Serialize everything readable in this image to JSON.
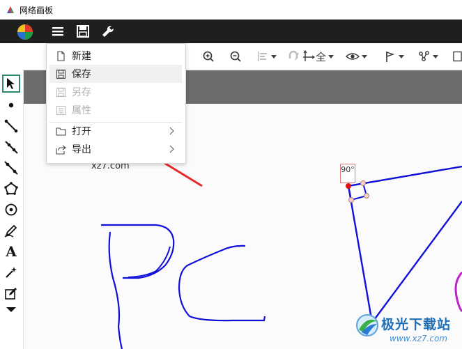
{
  "window": {
    "title": "网络画板"
  },
  "topbar": {
    "menu_icon": "hamburger-menu-icon",
    "save_icon": "floppy-disk-icon",
    "tools_icon": "wrench-icon"
  },
  "toolbar": {
    "view_all_label": "全"
  },
  "file_menu": {
    "items": [
      {
        "label": "新建",
        "icon": "new-file-icon",
        "enabled": true
      },
      {
        "label": "保存",
        "icon": "save-icon",
        "enabled": true
      },
      {
        "label": "另存",
        "icon": "save-as-icon",
        "enabled": false
      },
      {
        "label": "属性",
        "icon": "properties-icon",
        "enabled": false
      },
      {
        "label": "打开",
        "icon": "folder-icon",
        "enabled": true,
        "submenu": true
      },
      {
        "label": "导出",
        "icon": "export-icon",
        "enabled": true,
        "submenu": true
      }
    ]
  },
  "canvas": {
    "watermark_text": "xz7.com",
    "angle_label": "90°"
  },
  "corner_logo": {
    "brand": "极光下载站",
    "url": "www.xz7.com"
  },
  "colors": {
    "accent_line": "#1010d8",
    "point_red": "#e01010",
    "annotation_arrow": "#e52a2a"
  }
}
